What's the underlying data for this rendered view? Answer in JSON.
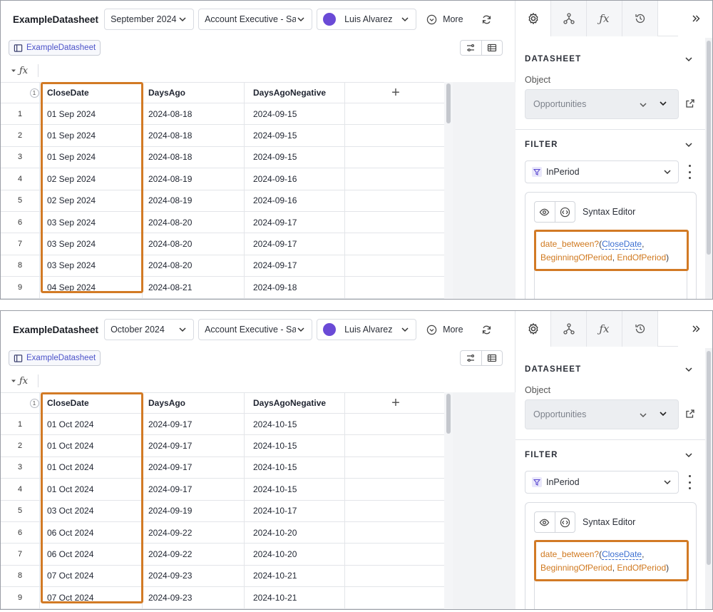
{
  "panels": [
    {
      "app_title": "ExampleDatasheet",
      "period": "September 2024",
      "role": "Account Executive - Sa",
      "user": "Luis Alvarez",
      "more_label": "More",
      "breadcrumb": "ExampleDatasheet",
      "columns": [
        "CloseDate",
        "DaysAgo",
        "DaysAgoNegative"
      ],
      "header_badge": "1",
      "rows": [
        {
          "n": "1",
          "close": "01 Sep 2024",
          "ago": "2024-08-18",
          "neg": "2024-09-15"
        },
        {
          "n": "2",
          "close": "01 Sep 2024",
          "ago": "2024-08-18",
          "neg": "2024-09-15"
        },
        {
          "n": "3",
          "close": "01 Sep 2024",
          "ago": "2024-08-18",
          "neg": "2024-09-15"
        },
        {
          "n": "4",
          "close": "02 Sep 2024",
          "ago": "2024-08-19",
          "neg": "2024-09-16"
        },
        {
          "n": "5",
          "close": "02 Sep 2024",
          "ago": "2024-08-19",
          "neg": "2024-09-16"
        },
        {
          "n": "6",
          "close": "03 Sep 2024",
          "ago": "2024-08-20",
          "neg": "2024-09-17"
        },
        {
          "n": "7",
          "close": "03 Sep 2024",
          "ago": "2024-08-20",
          "neg": "2024-09-17"
        },
        {
          "n": "8",
          "close": "03 Sep 2024",
          "ago": "2024-08-20",
          "neg": "2024-09-17"
        },
        {
          "n": "9",
          "close": "04 Sep 2024",
          "ago": "2024-08-21",
          "neg": "2024-09-18"
        }
      ],
      "side": {
        "datasheet_title": "DATASHEET",
        "object_label": "Object",
        "object_value": "Opportunities",
        "filter_title": "FILTER",
        "filter_value": "InPeriod",
        "editor_label": "Syntax Editor",
        "code": {
          "fn": "date_between?",
          "arg1": "CloseDate",
          "arg2": "BeginningOfPeriod",
          "arg3": "EndOfPeriod"
        }
      }
    },
    {
      "app_title": "ExampleDatasheet",
      "period": "October 2024",
      "role": "Account Executive - Sa",
      "user": "Luis Alvarez",
      "more_label": "More",
      "breadcrumb": "ExampleDatasheet",
      "columns": [
        "CloseDate",
        "DaysAgo",
        "DaysAgoNegative"
      ],
      "header_badge": "1",
      "rows": [
        {
          "n": "1",
          "close": "01 Oct 2024",
          "ago": "2024-09-17",
          "neg": "2024-10-15"
        },
        {
          "n": "2",
          "close": "01 Oct 2024",
          "ago": "2024-09-17",
          "neg": "2024-10-15"
        },
        {
          "n": "3",
          "close": "01 Oct 2024",
          "ago": "2024-09-17",
          "neg": "2024-10-15"
        },
        {
          "n": "4",
          "close": "01 Oct 2024",
          "ago": "2024-09-17",
          "neg": "2024-10-15"
        },
        {
          "n": "5",
          "close": "03 Oct 2024",
          "ago": "2024-09-19",
          "neg": "2024-10-17"
        },
        {
          "n": "6",
          "close": "06 Oct 2024",
          "ago": "2024-09-22",
          "neg": "2024-10-20"
        },
        {
          "n": "7",
          "close": "06 Oct 2024",
          "ago": "2024-09-22",
          "neg": "2024-10-20"
        },
        {
          "n": "8",
          "close": "07 Oct 2024",
          "ago": "2024-09-23",
          "neg": "2024-10-21"
        },
        {
          "n": "9",
          "close": "07 Oct 2024",
          "ago": "2024-09-23",
          "neg": "2024-10-21"
        }
      ],
      "side": {
        "datasheet_title": "DATASHEET",
        "object_label": "Object",
        "object_value": "Opportunities",
        "filter_title": "FILTER",
        "filter_value": "InPeriod",
        "editor_label": "Syntax Editor",
        "code": {
          "fn": "date_between?",
          "arg1": "CloseDate",
          "arg2": "BeginningOfPeriod",
          "arg3": "EndOfPeriod"
        }
      }
    }
  ],
  "icons": {
    "period_dropdown": "chevron-down-icon",
    "more": "chevron-circle-icon",
    "refresh": "refresh-icon",
    "breadcrumb": "table-icon",
    "view_toggle": [
      "sliders-icon",
      "grid-icon"
    ],
    "formula": "fx-icon",
    "side_tabs": [
      "gear-icon",
      "branch-icon",
      "fx-icon",
      "history-icon",
      "double-chevron-right-icon"
    ],
    "external_link": "external-link-icon",
    "filter": "filter-icon",
    "editor_tools": [
      "eye-icon",
      "code-icon"
    ]
  },
  "colors": {
    "highlight": "#d27a25",
    "avatar": "#6a4ad6",
    "chip_text": "#4b52c9",
    "code_fn": "#d0791f",
    "code_var": "#3b6fd1"
  }
}
